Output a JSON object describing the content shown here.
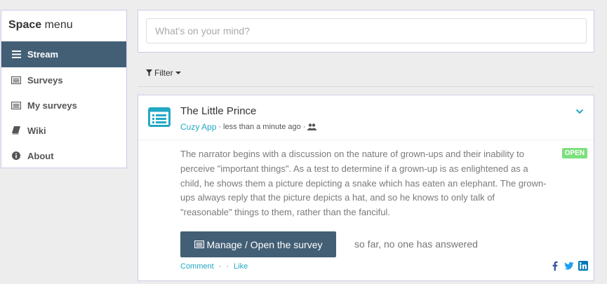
{
  "sidebar": {
    "title_bold": "Space",
    "title_rest": " menu",
    "items": [
      {
        "label": "Stream",
        "icon": "bars-icon",
        "active": true
      },
      {
        "label": "Surveys",
        "icon": "list-alt-icon",
        "active": false
      },
      {
        "label": "My surveys",
        "icon": "list-alt-icon",
        "active": false
      },
      {
        "label": "Wiki",
        "icon": "book-icon",
        "active": false
      },
      {
        "label": "About",
        "icon": "info-circle-icon",
        "active": false
      }
    ]
  },
  "composer": {
    "placeholder": "What's on your mind?"
  },
  "filter": {
    "label": "Filter"
  },
  "post": {
    "title": "The Little Prince",
    "author": "Cuzy App",
    "time": "less than a minute ago",
    "visibility_icon": "users-icon",
    "status": "OPEN",
    "body": "The narrator begins with a discussion on the nature of grown-ups and their inability to perceive \"important things\". As a test to determine if a grown-up is as enlightened as a child, he shows them a picture depicting a snake which has eaten an elephant. The grown-ups always reply that the picture depicts a hat, and so he knows to only talk of \"reasonable\" things to them, rather than the fanciful.",
    "manage_label": "Manage / Open the survey",
    "answers_note": "so far, no one has answered",
    "comment_label": "Comment",
    "like_label": "Like",
    "share_icons": [
      "facebook-icon",
      "twitter-icon",
      "linkedin-icon"
    ]
  },
  "colors": {
    "accent": "#435f75",
    "link": "#22a8c5",
    "status_open": "#7de07d",
    "border": "#c9cce6"
  }
}
